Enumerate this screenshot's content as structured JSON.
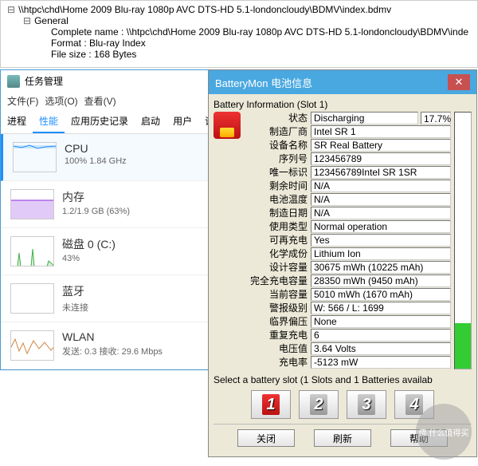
{
  "filetree": {
    "root": "\\\\htpc\\chd\\Home 2009 Blu-ray 1080p AVC DTS-HD 5.1-londoncloudy\\BDMV\\index.bdmv",
    "general": "General",
    "completeName": "Complete name : \\\\htpc\\chd\\Home 2009 Blu-ray 1080p AVC DTS-HD 5.1-londoncloudy\\BDMV\\inde",
    "format": "Format : Blu-ray Index",
    "fileSize": "File size : 168 Bytes"
  },
  "taskmgr": {
    "title": "任务管理",
    "menu": {
      "file": "文件(F)",
      "options": "选项(O)",
      "view": "查看(V)"
    },
    "tabs": {
      "process": "进程",
      "performance": "性能",
      "history": "应用历史记录",
      "startup": "启动",
      "users": "用户",
      "details": "详"
    },
    "cpu": {
      "name": "CPU",
      "stat": "100% 1.84 GHz",
      "color": "#1e90ff"
    },
    "memory": {
      "name": "内存",
      "stat": "1.2/1.9 GB (63%)",
      "color": "#8a2be2"
    },
    "disk": {
      "name": "磁盘 0 (C:)",
      "stat": "43%",
      "color": "#3cb043"
    },
    "bluetooth": {
      "name": "蓝牙",
      "stat": "未连接",
      "color": "#1e90ff"
    },
    "wlan": {
      "name": "WLAN",
      "stat": "发送: 0.3 接收: 29.6 Mbps",
      "color": "#cd853f"
    }
  },
  "batmon": {
    "title": "BatteryMon 电池信息",
    "heading": "Battery Information (Slot 1)",
    "percent": "17.7%",
    "rows": {
      "status": {
        "label": "状态",
        "value": "Discharging"
      },
      "manufacturer": {
        "label": "制造厂商",
        "value": "Intel SR 1"
      },
      "deviceName": {
        "label": "设备名称",
        "value": "SR Real Battery"
      },
      "serial": {
        "label": "序列号",
        "value": "123456789"
      },
      "uniqueId": {
        "label": "唯一标识",
        "value": "123456789Intel SR 1SR"
      },
      "remainTime": {
        "label": "剩余时间",
        "value": "N/A"
      },
      "temperature": {
        "label": "电池温度",
        "value": "N/A"
      },
      "mfgDate": {
        "label": "制造日期",
        "value": "N/A"
      },
      "usageType": {
        "label": "使用类型",
        "value": "Normal operation"
      },
      "rechargeable": {
        "label": "可再充电",
        "value": "Yes"
      },
      "chemistry": {
        "label": "化学成份",
        "value": "Lithium Ion"
      },
      "designCap": {
        "label": "设计容量",
        "value": "30675 mWh (10225 mAh)"
      },
      "fullCap": {
        "label": "完全充电容量",
        "value": "28350 mWh (9450 mAh)"
      },
      "currentCap": {
        "label": "当前容量",
        "value": "5010 mWh (1670 mAh)"
      },
      "alertLevel": {
        "label": "警报级别",
        "value": "W: 566 / L: 1699"
      },
      "criticalBias": {
        "label": "临界偏压",
        "value": "None"
      },
      "cycleCount": {
        "label": "重复充电",
        "value": "6"
      },
      "voltage": {
        "label": "电压值",
        "value": "3.64 Volts"
      },
      "chargeRate": {
        "label": "充电率",
        "value": "-5123 mW"
      }
    },
    "slotSelect": "Select a battery slot (1 Slots and 1 Batteries availab",
    "buttons": {
      "close": "关闭",
      "refresh": "刷新",
      "help": "帮助"
    },
    "slots": [
      "1",
      "2",
      "3",
      "4"
    ]
  },
  "watermark": "值 什么值得买"
}
